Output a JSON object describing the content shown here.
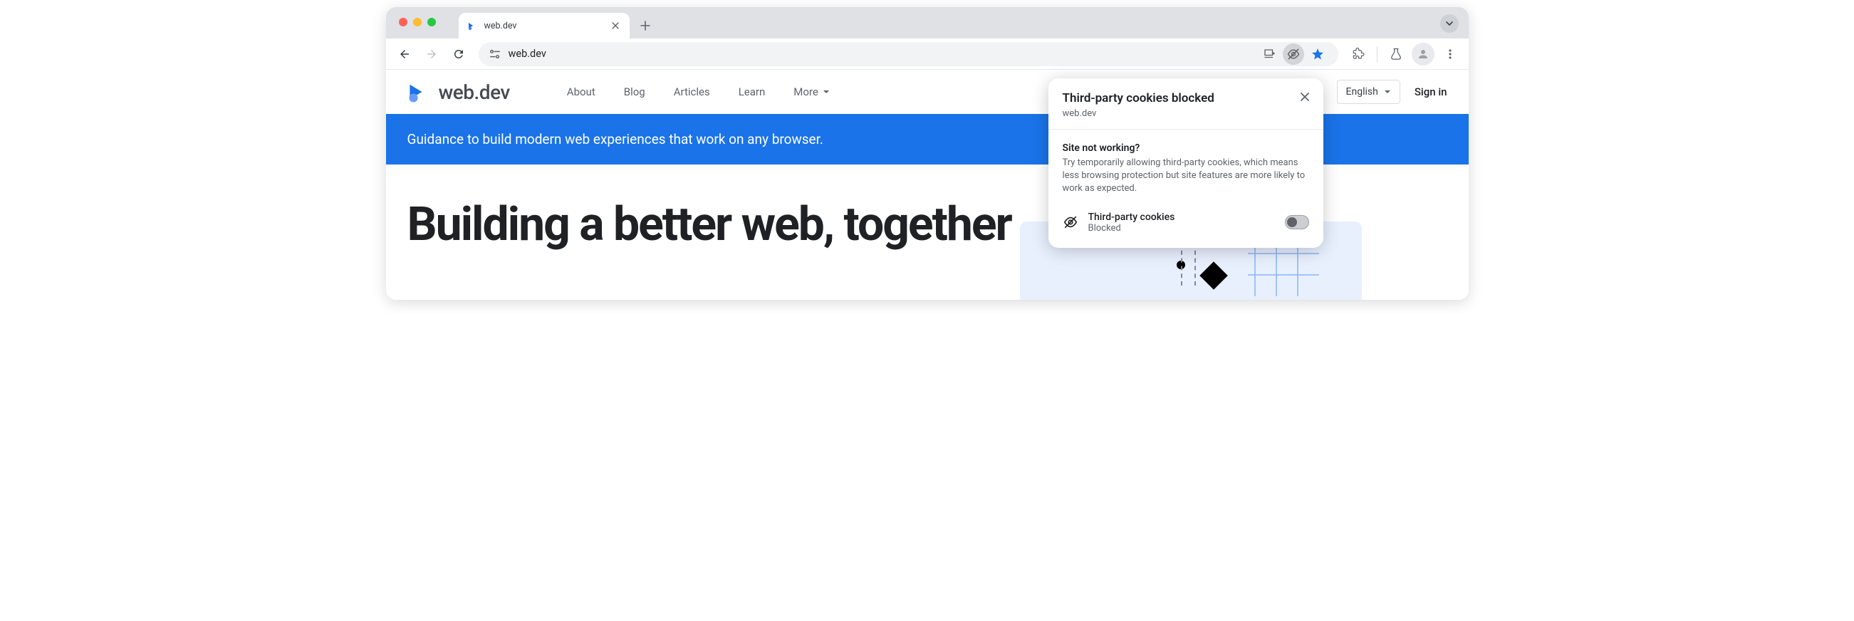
{
  "browser": {
    "tab_title": "web.dev",
    "url": "web.dev"
  },
  "site": {
    "logo": "web.dev",
    "nav": {
      "about": "About",
      "blog": "Blog",
      "articles": "Articles",
      "learn": "Learn",
      "more": "More"
    },
    "language": "English",
    "signin": "Sign in",
    "banner": "Guidance to build modern web experiences that work on any browser.",
    "hero_title": "Building a better web, together"
  },
  "popup": {
    "title": "Third-party cookies blocked",
    "host": "web.dev",
    "question": "Site not working?",
    "description": "Try temporarily allowing third-party cookies, which means less browsing protection but site features are more likely to work as expected.",
    "toggle_label": "Third-party cookies",
    "toggle_status": "Blocked"
  }
}
